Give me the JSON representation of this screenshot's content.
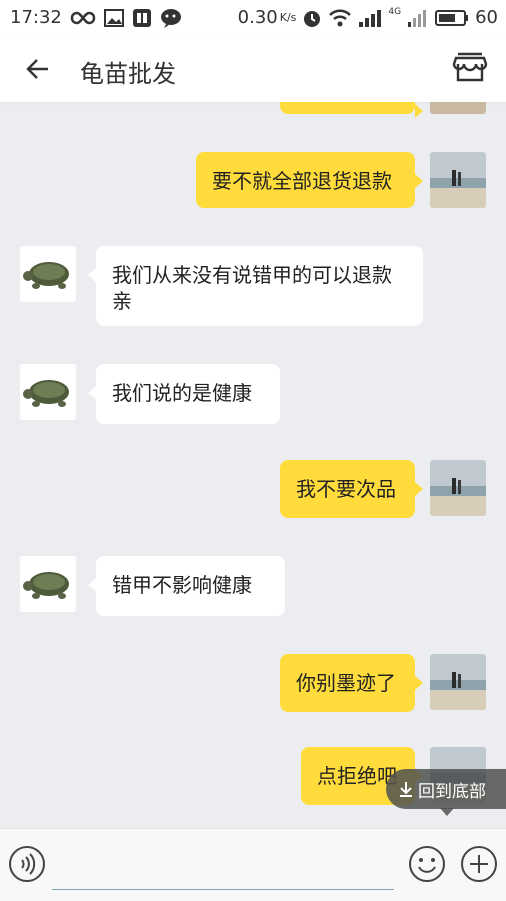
{
  "status_bar": {
    "time": "17:32",
    "speed": "0.30",
    "speed_unit": "K/s",
    "network": "4G",
    "battery": "60",
    "left_icons": [
      "infinity-icon",
      "gallery-icon",
      "tieba-icon",
      "wechat-icon"
    ]
  },
  "header": {
    "title": "龟苗批发"
  },
  "messages": [
    {
      "from": "user",
      "text": "要不就全部退货退款"
    },
    {
      "from": "seller",
      "text": "我们从来没有说错甲的可以退款亲"
    },
    {
      "from": "seller",
      "text": "我们说的是健康"
    },
    {
      "from": "user",
      "text": "我不要次品"
    },
    {
      "from": "seller",
      "text": "错甲不影响健康"
    },
    {
      "from": "user",
      "text": "你别墨迹了"
    },
    {
      "from": "user",
      "text": "点拒绝吧"
    }
  ],
  "scroll_to_bottom": {
    "label": "回到底部"
  },
  "input": {
    "placeholder": ""
  },
  "colors": {
    "user_bubble": "#FFDC3C",
    "seller_bubble": "#FFFFFF",
    "chat_background": "#ECEDF1"
  }
}
